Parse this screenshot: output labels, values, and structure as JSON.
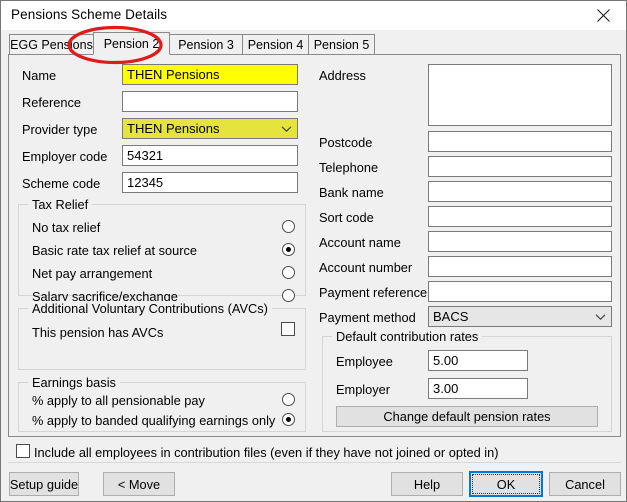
{
  "window": {
    "title": "Pensions Scheme Details",
    "close_icon": "close-icon"
  },
  "tabs": [
    {
      "label": "EGG Pensions",
      "selected": false
    },
    {
      "label": "Pension 2",
      "selected": true
    },
    {
      "label": "Pension 3",
      "selected": false
    },
    {
      "label": "Pension 4",
      "selected": false
    },
    {
      "label": "Pension 5",
      "selected": false
    }
  ],
  "left_column": {
    "name": {
      "label": "Name",
      "value": "THEN Pensions",
      "highlight": "#ffff00"
    },
    "reference": {
      "label": "Reference",
      "value": "",
      "placeholder": ""
    },
    "provider_type": {
      "label": "Provider type",
      "value": "THEN Pensions",
      "highlight": "#e4e43c"
    },
    "employer_code": {
      "label": "Employer code",
      "value": "54321"
    },
    "scheme_code": {
      "label": "Scheme code",
      "value": "12345"
    }
  },
  "tax_relief": {
    "title": "Tax Relief",
    "options": [
      {
        "label": "No tax relief",
        "selected": false
      },
      {
        "label": "Basic rate tax relief at source",
        "selected": true
      },
      {
        "label": "Net pay arrangement",
        "selected": false
      },
      {
        "label": "Salary sacrifice/exchange",
        "selected": false
      }
    ]
  },
  "avc": {
    "title": "Additional Voluntary Contributions (AVCs)",
    "checkbox_label": "This pension has AVCs",
    "checked": false
  },
  "earnings_basis": {
    "title": "Earnings basis",
    "options": [
      {
        "label": "% apply to all pensionable pay",
        "selected": false
      },
      {
        "label": "% apply to banded qualifying earnings only",
        "selected": true
      }
    ]
  },
  "right_column": {
    "address": {
      "label": "Address",
      "value": ""
    },
    "postcode": {
      "label": "Postcode",
      "value": ""
    },
    "telephone": {
      "label": "Telephone",
      "value": ""
    },
    "bank_name": {
      "label": "Bank name",
      "value": ""
    },
    "sort_code": {
      "label": "Sort code",
      "value": ""
    },
    "account_name": {
      "label": "Account name",
      "value": ""
    },
    "account_number": {
      "label": "Account number",
      "value": ""
    },
    "payment_reference": {
      "label": "Payment reference",
      "value": ""
    },
    "payment_method": {
      "label": "Payment method",
      "value": "BACS"
    }
  },
  "contribution_rates": {
    "title": "Default contribution rates",
    "employee": {
      "label": "Employee",
      "value": "5.00"
    },
    "employer": {
      "label": "Employer",
      "value": "3.00"
    },
    "change_button": "Change default pension rates"
  },
  "include_all": {
    "label": "Include all employees in contribution files (even if they have not joined or opted in)",
    "checked": false
  },
  "footer_buttons": {
    "setup_guide": "Setup guide",
    "move": "< Move",
    "help": "Help",
    "ok": "OK",
    "cancel": "Cancel"
  },
  "annotation": {
    "shape": "ellipse",
    "color": "#e01b1b",
    "target": "Pension 2"
  }
}
